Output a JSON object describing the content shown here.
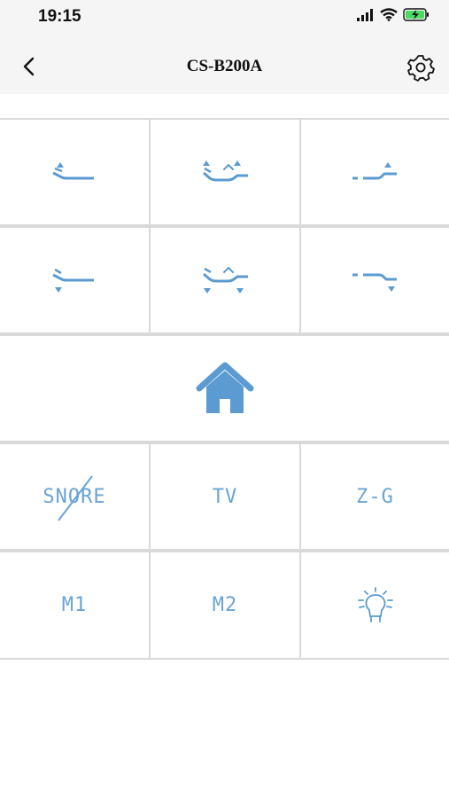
{
  "status_bar": {
    "time": "19:15"
  },
  "header": {
    "title": "CS-B200A"
  },
  "buttons": {
    "row1": [
      "head-up-icon",
      "head-foot-up-icon",
      "foot-up-icon"
    ],
    "row2": [
      "head-down-icon",
      "head-foot-down-icon",
      "foot-down-icon"
    ],
    "home": "home-icon",
    "row4": {
      "snore": "SNORE",
      "tv": "TV",
      "zg": "Z-G"
    },
    "row5": {
      "m1": "M1",
      "m2": "M2",
      "light": "light-bulb-icon"
    }
  },
  "colors": {
    "accent": "#5b9bd1",
    "label": "#6aa3d5",
    "divider": "#d9d9d9"
  }
}
